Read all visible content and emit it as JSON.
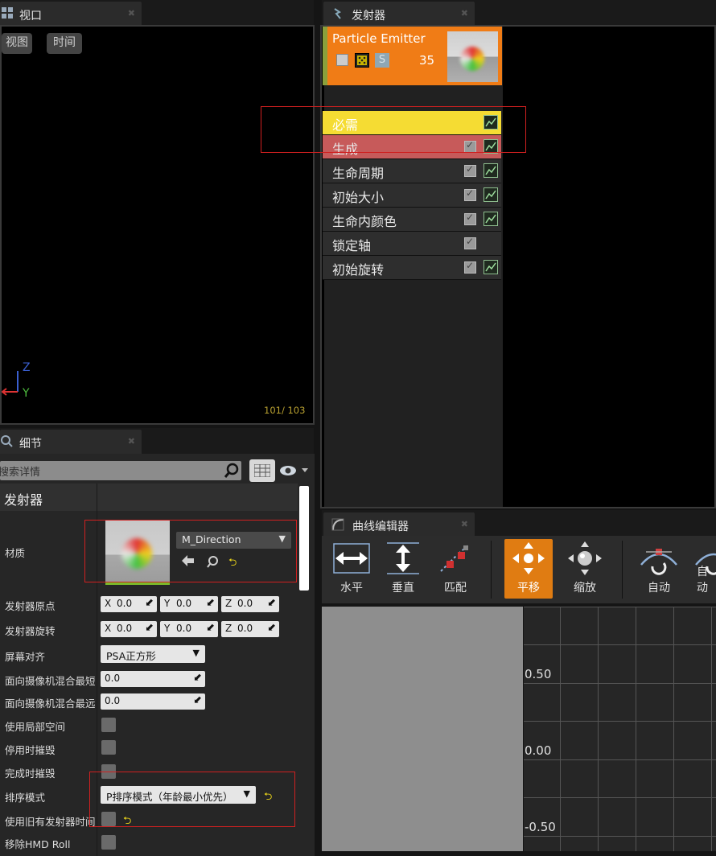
{
  "viewport": {
    "tab_title": "视口",
    "view_button": "视图",
    "time_button": "时间",
    "axis_z": "Z",
    "axis_y": "Y",
    "counter": "101/ 103"
  },
  "emitter": {
    "tab_title": "发射器",
    "card_title": "Particle Emitter",
    "card_count": "35",
    "solo_label": "S",
    "modules": [
      {
        "label": "必需"
      },
      {
        "label": "生成"
      },
      {
        "label": "生命周期"
      },
      {
        "label": "初始大小"
      },
      {
        "label": "生命内颜色"
      },
      {
        "label": "锁定轴"
      },
      {
        "label": "初始旋转"
      }
    ]
  },
  "details": {
    "tab_title": "细节",
    "search_placeholder": "搜索详情",
    "section_title": "发射器",
    "material_label": "材质",
    "material_value": "M_Direction",
    "labels": {
      "origin": "发射器原点",
      "rotation": "发射器旋转",
      "screen_align": "屏幕对齐",
      "cam_blend_min": "面向摄像机混合最短",
      "cam_blend_max": "面向摄像机混合最远",
      "local_space": "使用局部空间",
      "kill_on_deactivate": "停用时摧毁",
      "kill_on_complete": "完成时摧毁",
      "sort_mode": "排序模式",
      "use_legacy_time": "使用旧有发射器时间",
      "remove_hmd_roll": "移除HMD Roll"
    },
    "origin": {
      "x": "0.0",
      "y": "0.0",
      "z": "0.0"
    },
    "rotation": {
      "x": "0.0",
      "y": "0.0",
      "z": "0.0"
    },
    "axis_x": "X",
    "axis_y": "Y",
    "axis_z": "Z",
    "screen_align_value": "PSA正方形",
    "cam_blend_min_value": "0.0",
    "cam_blend_max_value": "0.0",
    "sort_mode_value": "P排序模式（年龄最小优先）"
  },
  "curve_editor": {
    "tab_title": "曲线编辑器",
    "tools": {
      "horizontal": "水平",
      "vertical": "垂直",
      "fit": "匹配",
      "pan": "平移",
      "zoom": "缩放",
      "auto": "自动",
      "auto2": "自动"
    },
    "y_labels": [
      "0.50",
      "0.00",
      "-0.50"
    ]
  },
  "colors": {
    "accent_orange": "#f07c16",
    "required_yellow": "#f5dc33",
    "spawn_red": "#c75a5a"
  }
}
